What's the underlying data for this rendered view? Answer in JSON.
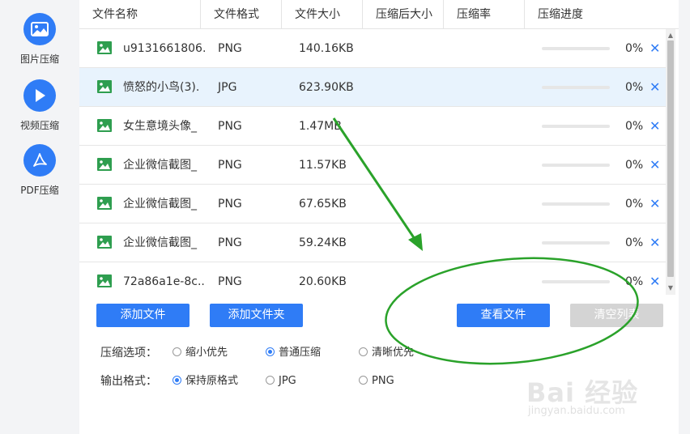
{
  "sidebar": {
    "items": [
      {
        "label": "图片压缩",
        "icon": "image-icon"
      },
      {
        "label": "视频压缩",
        "icon": "play-icon"
      },
      {
        "label": "PDF压缩",
        "icon": "pdf-icon"
      }
    ]
  },
  "table": {
    "columns": [
      "文件名称",
      "文件格式",
      "文件大小",
      "压缩后大小",
      "压缩率",
      "压缩进度"
    ],
    "rows": [
      {
        "name": "u9131661806...",
        "format": "PNG",
        "size": "140.16KB",
        "progress": "0%",
        "progress_value": 0,
        "selected": false
      },
      {
        "name": "愤怒的小鸟(3).",
        "format": "JPG",
        "size": "623.90KB",
        "progress": "0%",
        "progress_value": 0,
        "selected": true
      },
      {
        "name": "女生意境头像_",
        "format": "PNG",
        "size": "1.47MB",
        "progress": "0%",
        "progress_value": 0,
        "selected": false
      },
      {
        "name": "企业微信截图_",
        "format": "PNG",
        "size": "11.57KB",
        "progress": "0%",
        "progress_value": 0,
        "selected": false
      },
      {
        "name": "企业微信截图_",
        "format": "PNG",
        "size": "67.65KB",
        "progress": "0%",
        "progress_value": 0,
        "selected": false
      },
      {
        "name": "企业微信截图_",
        "format": "PNG",
        "size": "59.24KB",
        "progress": "0%",
        "progress_value": 0,
        "selected": false
      },
      {
        "name": "72a86a1e-8c...",
        "format": "PNG",
        "size": "20.60KB",
        "progress": "0%",
        "progress_value": 0,
        "selected": false
      }
    ],
    "remove_glyph": "✕"
  },
  "buttons": {
    "add_file": "添加文件",
    "add_folder": "添加文件夹",
    "view_files": "查看文件",
    "clear_list": "清空列表"
  },
  "options": {
    "compress_title": "压缩选项：",
    "compress_choices": [
      {
        "label": "缩小优先",
        "checked": false
      },
      {
        "label": "普通压缩",
        "checked": true
      },
      {
        "label": "清晰优先",
        "checked": false
      }
    ],
    "output_title": "输出格式：",
    "output_choices": [
      {
        "label": "保持原格式",
        "checked": true
      },
      {
        "label": "JPG",
        "checked": false
      },
      {
        "label": "PNG",
        "checked": false
      }
    ]
  },
  "watermark": {
    "brand": "Bai 经验",
    "url": "jingyan.baidu.com"
  },
  "colors": {
    "accent": "#2f7cf6",
    "selected_row": "#e8f3fd",
    "annotation": "#2aa22a",
    "disabled_button": "#d4d4d4"
  }
}
